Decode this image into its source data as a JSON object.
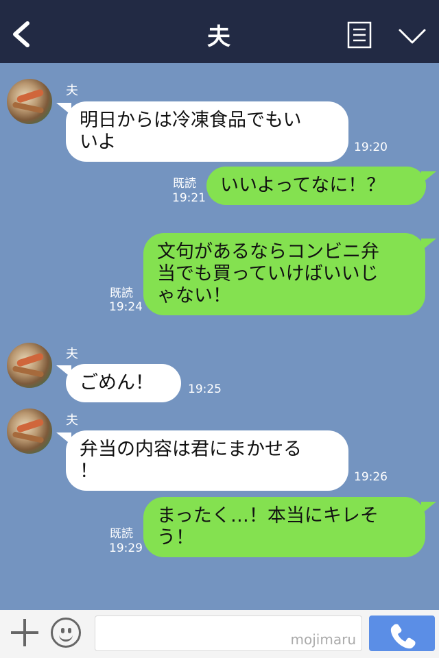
{
  "header": {
    "title": "夫"
  },
  "messages": [
    {
      "sender": "夫",
      "text": "明日からは冷凍食品でもい\nいよ",
      "time": "19:20"
    },
    {
      "read": "既読",
      "text": "いいよってなに！？",
      "time": "19:21"
    },
    {
      "read": "既読",
      "text": "文句があるならコンビニ弁\n当でも買っていけばいいじ\nゃない！",
      "time": "19:24"
    },
    {
      "sender": "夫",
      "text": "ごめん！",
      "time": "19:25"
    },
    {
      "sender": "夫",
      "text": "弁当の内容は君にまかせる\n！",
      "time": "19:26"
    },
    {
      "read": "既読",
      "text": "まったく…！本当にキレそ\nう！",
      "time": "19:29"
    }
  ],
  "footer": {
    "watermark": "mojimaru"
  },
  "colors": {
    "header_bg": "#222a44",
    "chat_bg": "#7494c0",
    "outgoing_bubble": "#84e150",
    "incoming_bubble": "#ffffff",
    "call_button": "#5b8ee6"
  },
  "icons": {
    "back": "chevron-left-icon",
    "menu": "document-list-icon",
    "collapse": "chevron-down-icon",
    "add": "plus-icon",
    "emoji": "smiley-icon",
    "call": "phone-icon"
  }
}
